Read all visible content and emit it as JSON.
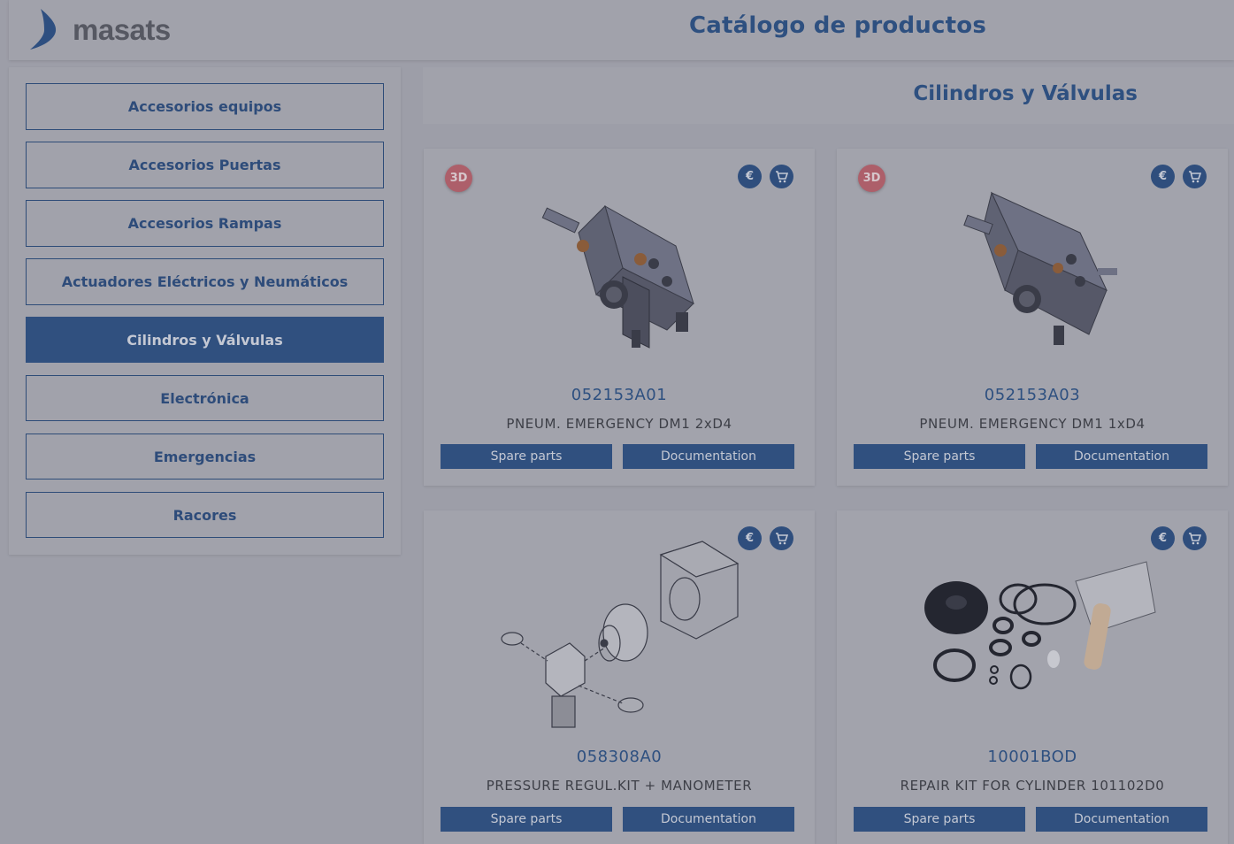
{
  "header": {
    "logo_text": "masats",
    "title": "Catálogo de productos"
  },
  "sidebar": {
    "items": [
      {
        "label": "Accesorios equipos",
        "active": false
      },
      {
        "label": "Accesorios Puertas",
        "active": false
      },
      {
        "label": "Accesorios Rampas",
        "active": false
      },
      {
        "label": "Actuadores Eléctricos y Neumáticos",
        "active": false
      },
      {
        "label": "Cilindros y Válvulas",
        "active": true
      },
      {
        "label": "Electrónica",
        "active": false
      },
      {
        "label": "Emergencias",
        "active": false
      },
      {
        "label": "Racores",
        "active": false
      }
    ]
  },
  "section": {
    "title": "Cilindros y Válvulas"
  },
  "products": [
    {
      "badge": "3D",
      "code": "052153A01",
      "description": "PNEUM. EMERGENCY DM1 2xD4",
      "price_icon": "€",
      "image": "valve-block-icon"
    },
    {
      "badge": "3D",
      "code": "052153A03",
      "description": "PNEUM. EMERGENCY DM1 1xD4",
      "price_icon": "€",
      "image": "valve-block-icon"
    },
    {
      "badge": "",
      "code": "058308A0",
      "description": "PRESSURE REGUL.KIT + MANOMETER",
      "price_icon": "€",
      "image": "regulator-kit-icon"
    },
    {
      "badge": "",
      "code": "10001BOD",
      "description": "REPAIR KIT FOR CYLINDER 101102D0",
      "price_icon": "€",
      "image": "repair-kit-icon"
    }
  ],
  "buttons": {
    "spare_parts": "Spare parts",
    "documentation": "Documentation"
  },
  "colors": {
    "primary": "#30507f",
    "badge_3d": "#ad5f6a",
    "overlay_bg": "#9d9ea8"
  }
}
